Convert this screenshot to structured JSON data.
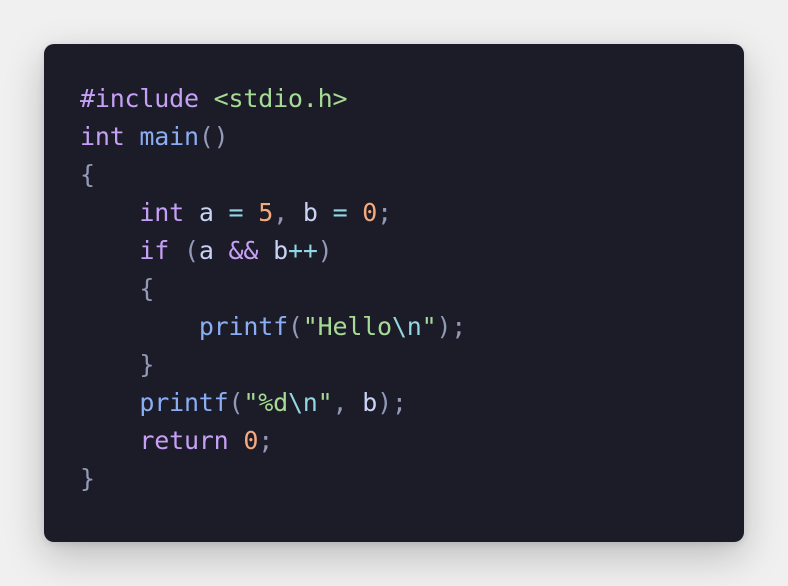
{
  "code_snippet": {
    "language": "C",
    "lines": [
      "#include <stdio.h>",
      "int main()",
      "{",
      "    int a = 5, b = 0;",
      "    if (a && b++)",
      "    {",
      "        printf(\"Hello\\n\");",
      "    }",
      "    printf(\"%d\\n\", b);",
      "    return 0;",
      "}"
    ]
  },
  "colors": {
    "page_background": "#f0f0f0",
    "card_background": "#1b1c28",
    "keyword": "#c6a0f6",
    "function": "#8aadf4",
    "string": "#a6da95",
    "number": "#f5a97f",
    "escape_and_operator": "#91d7e3",
    "identifier": "#cad3f5",
    "punctuation": "#939ab7"
  }
}
